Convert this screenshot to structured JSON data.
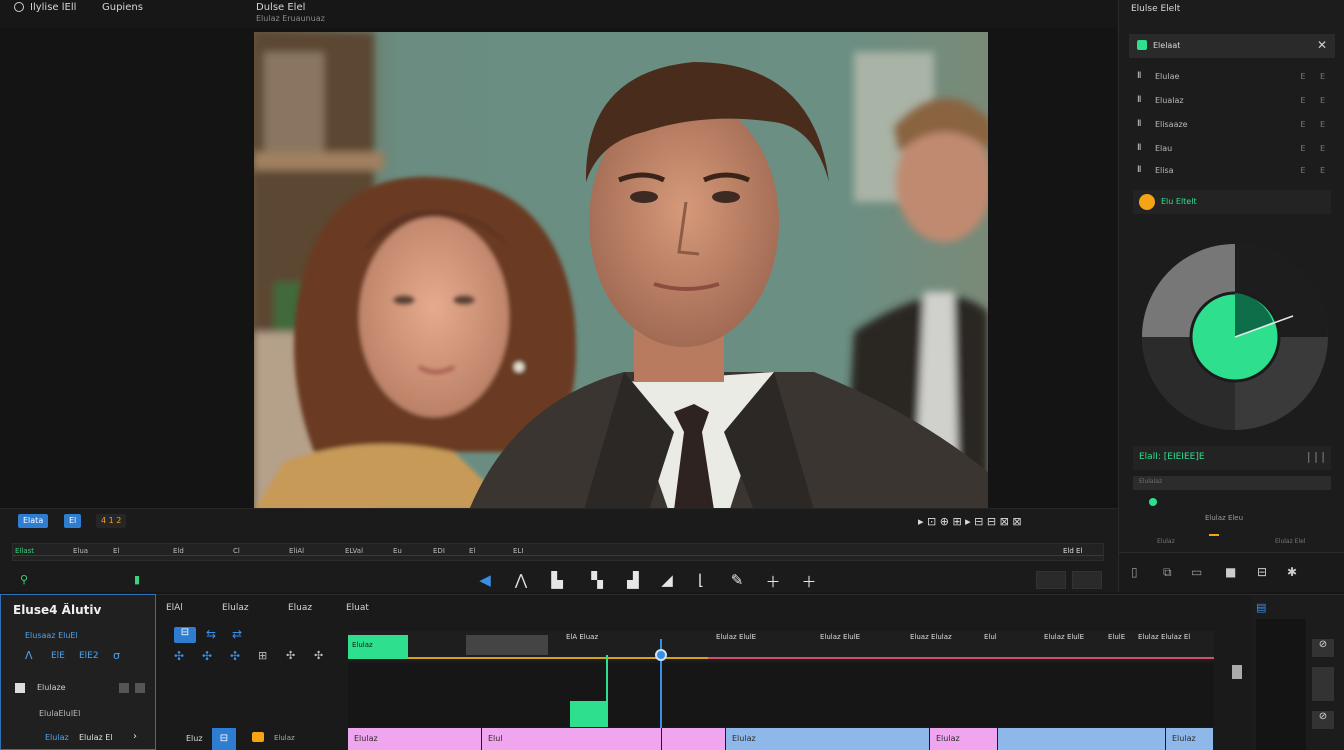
{
  "topbar": {
    "menu_left": "Ilylise lEll",
    "menu_mid": "Gupiens",
    "viewer_title": "Dulse Elel",
    "viewer_subtitle": "Elulaz Eruaunuaz"
  },
  "transport": {
    "chip_a": "Elata",
    "chip_b": "El",
    "chip_c": "4 1 2",
    "row_labels": [
      "Ellast",
      "Elua",
      "El",
      "Eld",
      "Cl",
      "EliAl",
      "ELVal",
      "Eu",
      "EDI",
      "El",
      "ELI"
    ],
    "right_labels": [
      "E",
      "Eld",
      "Etl",
      "El",
      "Elsl",
      "Elsl"
    ],
    "right_status": "Eld El",
    "tool_icons": [
      "arrow-icon",
      "caret-icon",
      "marker-icon",
      "blade-icon",
      "slip-icon",
      "wedge-icon",
      "hook-icon",
      "pen-icon",
      "plus-icon",
      "plus-icon"
    ]
  },
  "inspector": {
    "title": "Elulse Elelt",
    "active_header": "Elelaat",
    "rows": [
      {
        "icon": "Ⅱ",
        "label": "Elulae",
        "val": "E E"
      },
      {
        "icon": "Ⅱ",
        "label": "Elualaz",
        "val": "E E"
      },
      {
        "icon": "Ⅱ",
        "label": "Elisaaze",
        "val": "E E"
      },
      {
        "icon": "Ⅱ",
        "label": "Elau",
        "val": "E E"
      },
      {
        "icon": "Ⅱ",
        "label": "Elisa",
        "val": "E E"
      }
    ],
    "orange_label": "Elu Eltelt",
    "readout": "ElalI: [EIEIEE]E",
    "readout_sub": "Elulalaz",
    "bottom_text": "Elulaz Eleu",
    "bottom_tabs": [
      "Elulaz",
      "Elulaz Elel"
    ],
    "wheel_colors": {
      "accent": "#2ee08e",
      "orange": "#f6a316",
      "blue": "#3b8ee6"
    }
  },
  "left_panel": {
    "title": "Eluse4 Älutiv",
    "subtitle": "Elusaaz EluEl",
    "controls": [
      "Λ",
      "ElE",
      "ElE2",
      "σ"
    ],
    "row1": "Elulaze",
    "row2": "ElulaElulEl",
    "row3": "Elulaz El",
    "row3_a": "Elulaz"
  },
  "timeline": {
    "tabs": [
      "ElAl",
      "Elulaz",
      "Eluaz",
      "Eluat"
    ],
    "ruler_labels": [
      "ElA Eluaz",
      "Elulaz ElulE",
      "Elulaz ElulE",
      "Eluaz Elulaz",
      "Elul",
      "Elulaz ElulE",
      "ElulE",
      "Elulaz Elulaz El"
    ],
    "green_clip": "Elulaz",
    "track_label": "Eluz",
    "track_a": "Elulaz",
    "clips": [
      {
        "label": "Elulaz",
        "color": "#f0a6ef"
      },
      {
        "label": "Elul",
        "color": "#f0a6ef"
      },
      {
        "label": "",
        "color": "#f0a6ef"
      },
      {
        "label": "Elulaz",
        "color": "#8fb8ea"
      },
      {
        "label": "Elulaz",
        "color": "#f0a6ef"
      },
      {
        "label": "",
        "color": "#8fb8ea"
      },
      {
        "label": "Elulaz",
        "color": "#8fb8ea"
      }
    ]
  }
}
